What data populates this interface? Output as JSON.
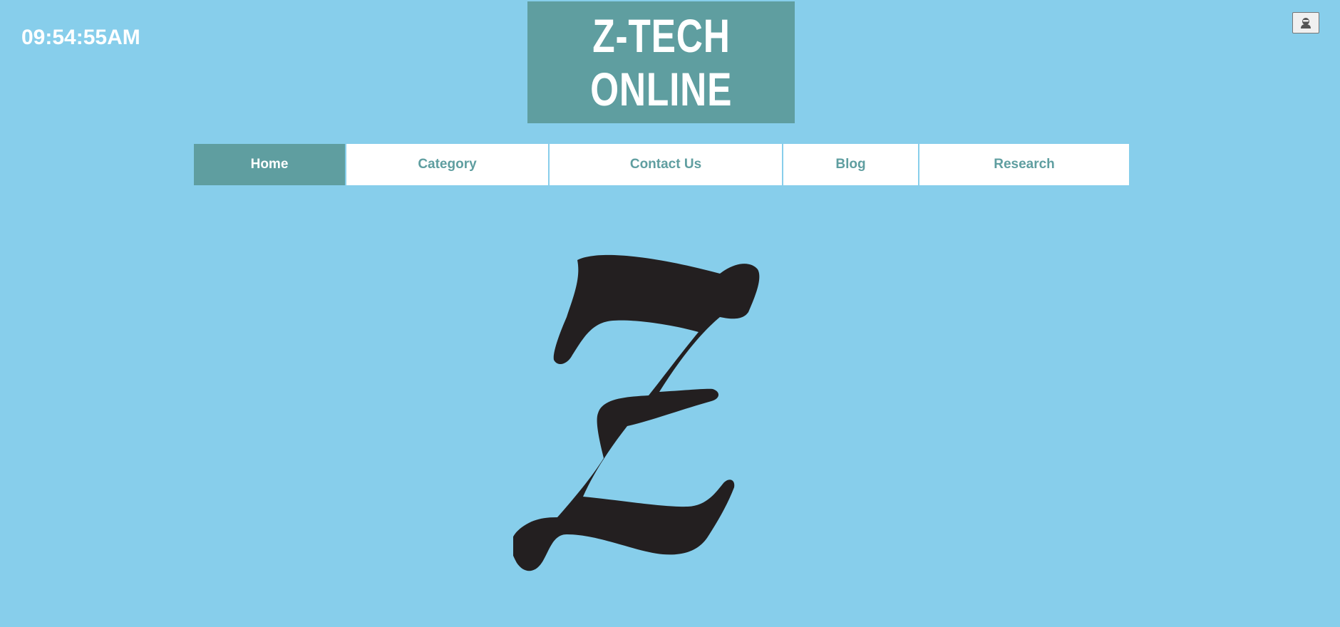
{
  "clock": {
    "time": "09:54:55AM"
  },
  "brand": {
    "line1": "Z-TECH",
    "line2": "ONLINE"
  },
  "user_button": {
    "icon": "user-icon"
  },
  "nav": {
    "items": [
      {
        "label": "Home",
        "active": true
      },
      {
        "label": "Category",
        "active": false
      },
      {
        "label": "Contact Us",
        "active": false
      },
      {
        "label": "Blog",
        "active": false
      },
      {
        "label": "Research",
        "active": false
      }
    ]
  },
  "hero": {
    "icon": "z-logo-icon"
  },
  "colors": {
    "background": "#87ceeb",
    "accent": "#5f9ea0",
    "nav_background": "#ffffff",
    "logo_fill": "#231f20"
  }
}
